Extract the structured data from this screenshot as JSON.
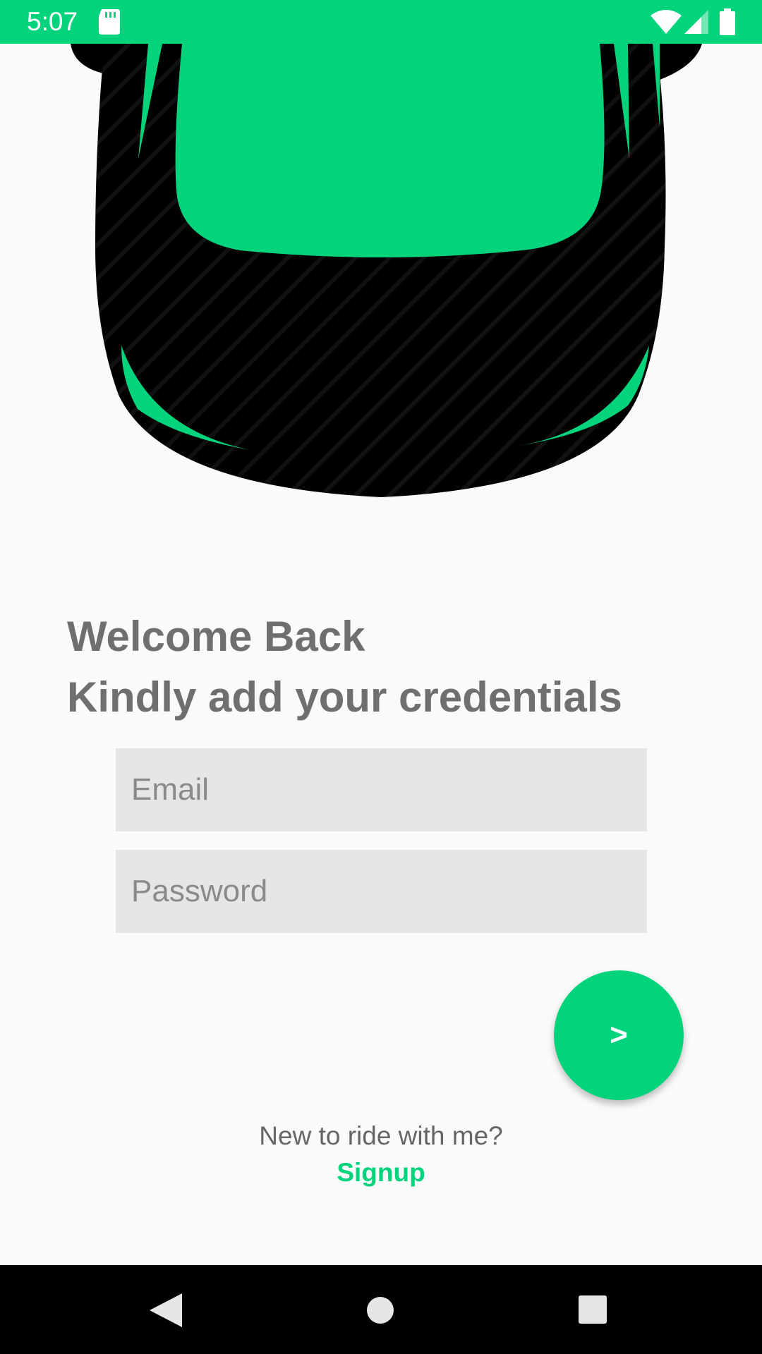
{
  "status_bar": {
    "time": "5:07",
    "icons": [
      "sd-card-icon",
      "wifi-icon",
      "cell-signal-icon",
      "battery-icon"
    ],
    "background": "#03d47c"
  },
  "hero": {
    "illustration": "car-top-view",
    "car_body_color": "#000000",
    "car_accent_color": "#03d47c"
  },
  "heading": {
    "line1": "Welcome Back",
    "line2": "Kindly add your credentials"
  },
  "form": {
    "email_placeholder": "Email",
    "email_value": "",
    "password_placeholder": "Password",
    "password_value": "",
    "submit_label": ">"
  },
  "signup": {
    "prompt": "New to ride with me?",
    "link_label": "Signup"
  },
  "nav_bar": {
    "icons": [
      "back-icon",
      "home-icon",
      "recents-icon"
    ]
  },
  "colors": {
    "accent": "#03d47c",
    "heading_text": "#6f6f6f",
    "input_background": "#e4e7e4",
    "page_background": "#fafafa"
  }
}
